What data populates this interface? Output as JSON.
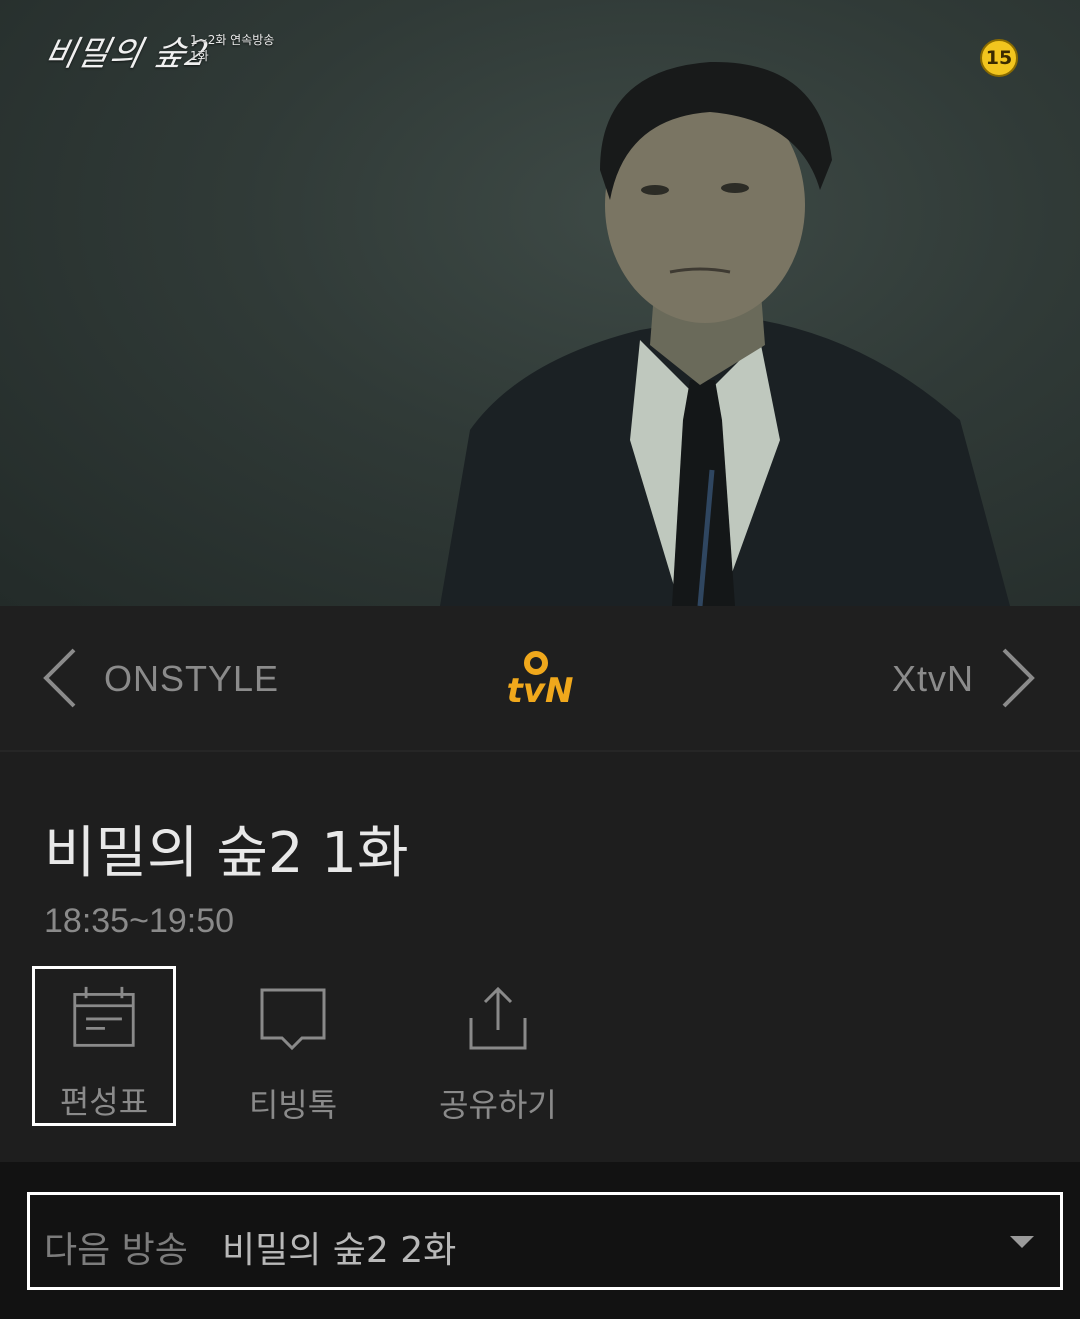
{
  "video": {
    "show_logo": "비밀의 숲2",
    "overlay_line1": "1~2화 연속방송",
    "overlay_line2": "1화",
    "age_rating": "15"
  },
  "channels": {
    "previous": "ONSTYLE",
    "current": "tvN",
    "next": "XtvN",
    "current_color": "#f0a81c"
  },
  "program": {
    "title": "비밀의 숲2 1화",
    "time": "18:35~19:50",
    "actions": [
      {
        "label": "편성표",
        "icon": "calendar-icon"
      },
      {
        "label": "티빙톡",
        "icon": "chat-bubble-icon"
      },
      {
        "label": "공유하기",
        "icon": "share-icon"
      }
    ]
  },
  "next_broadcast": {
    "label": "다음 방송",
    "title": "비밀의 숲2 2화"
  }
}
